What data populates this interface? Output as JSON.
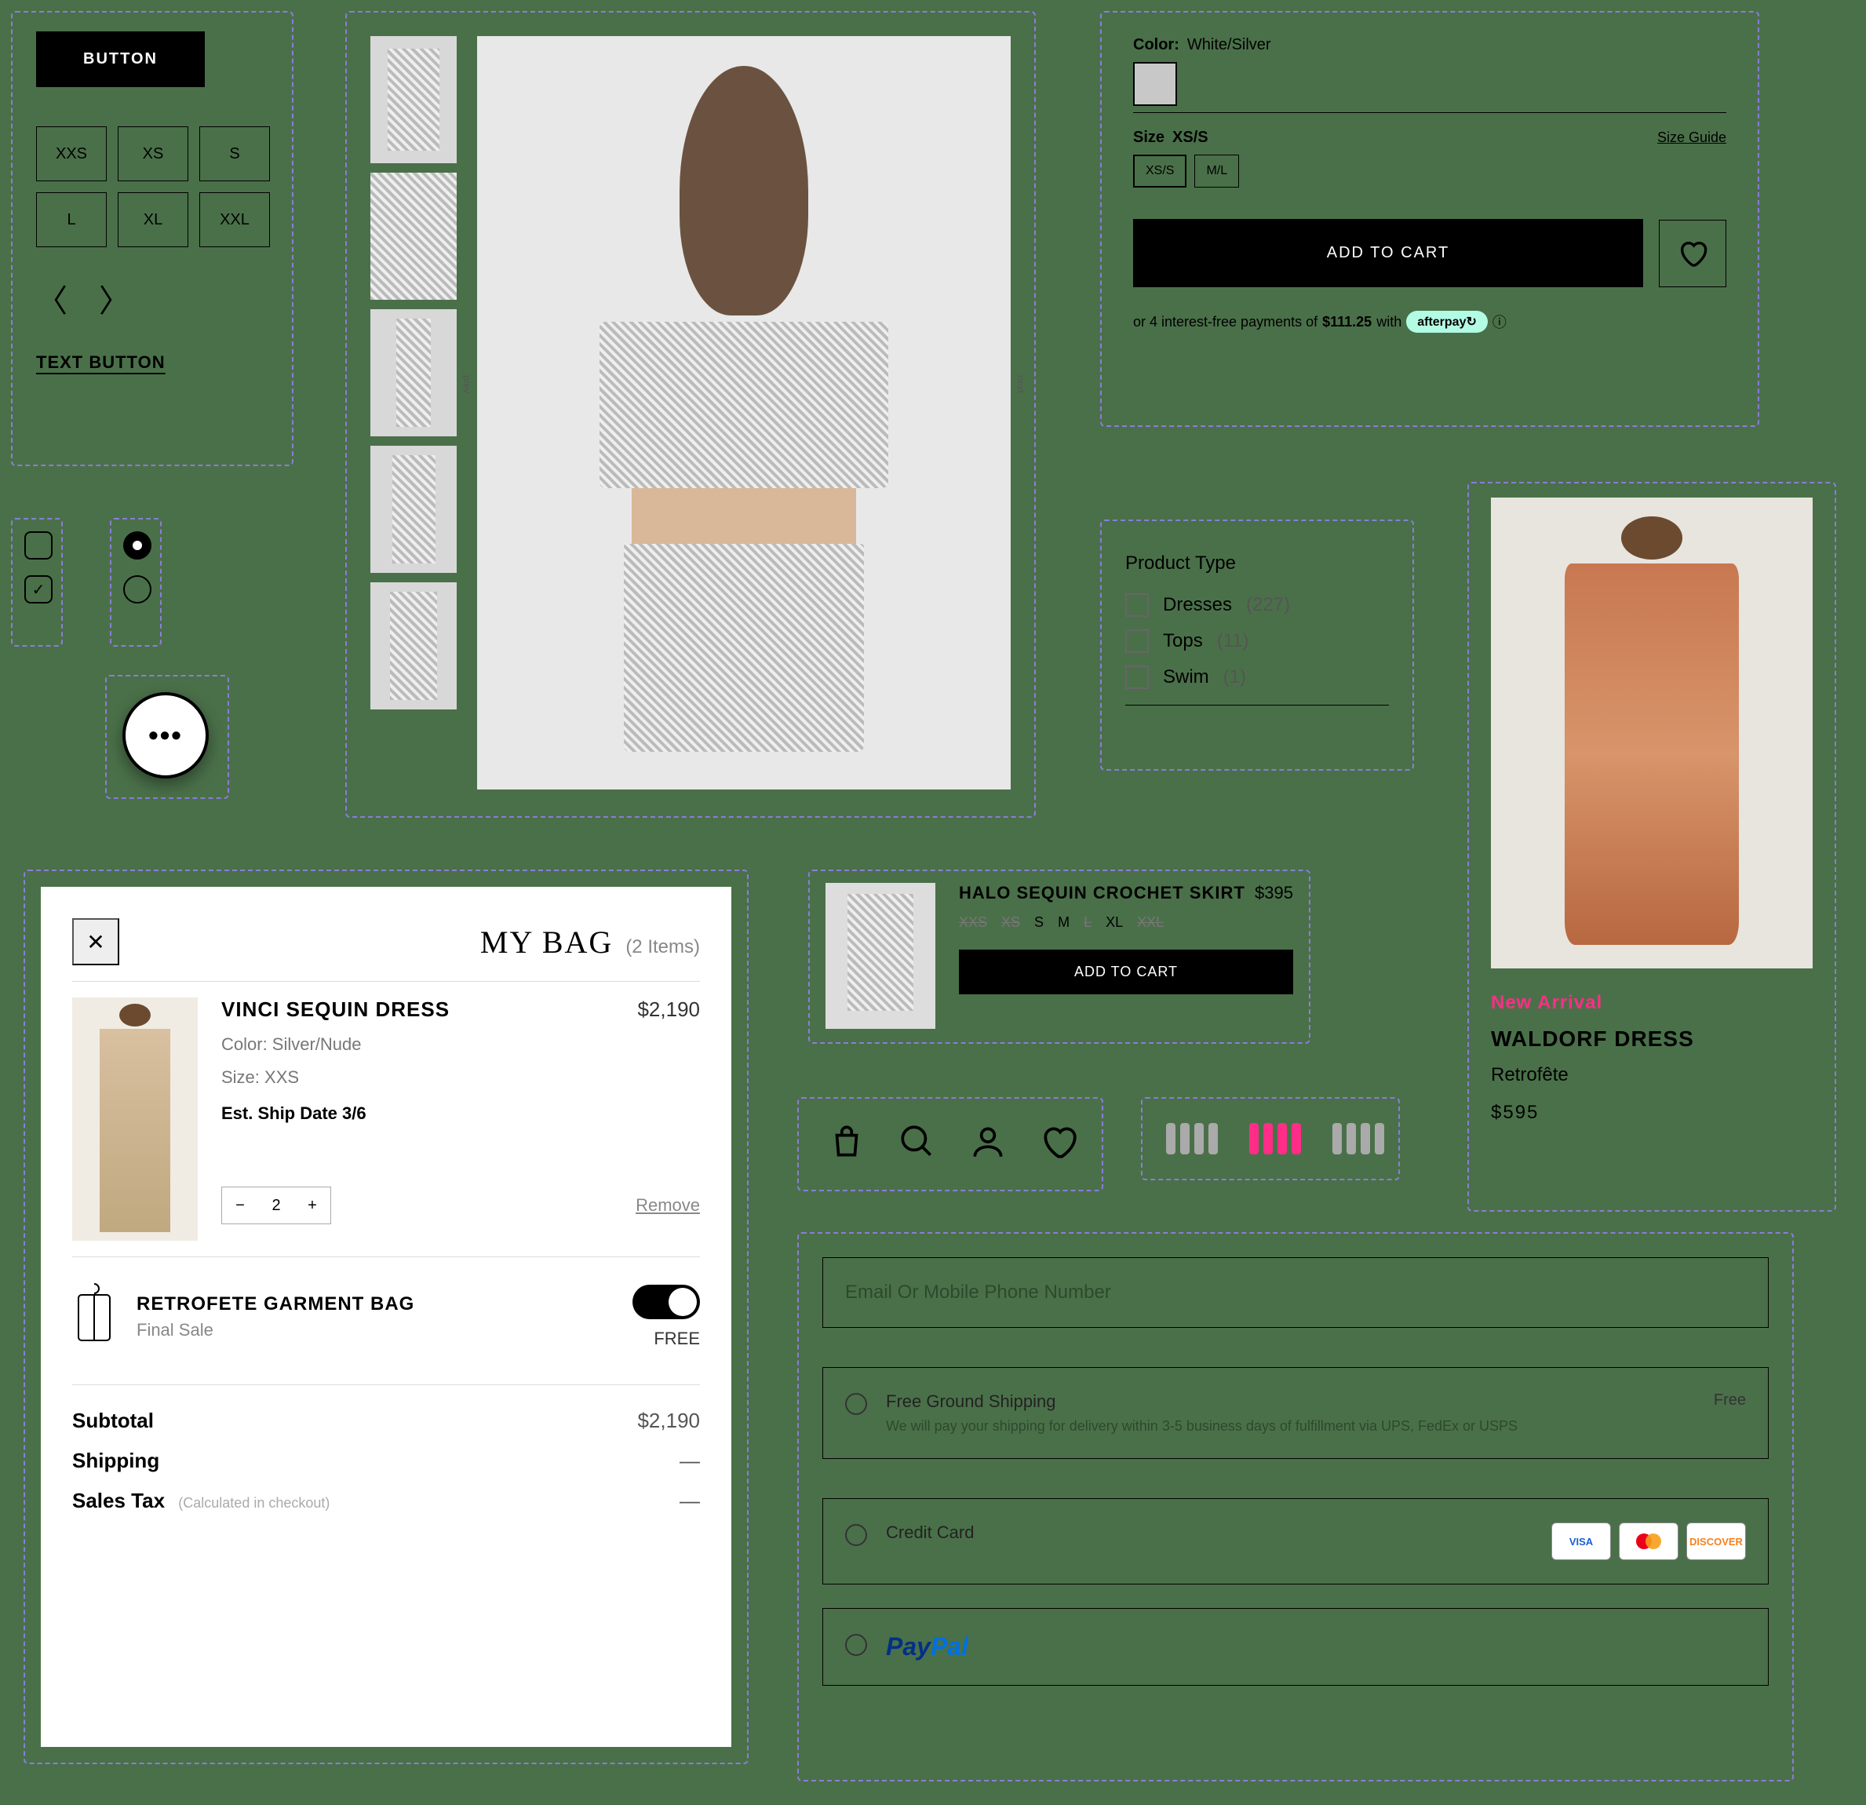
{
  "controls": {
    "primary_button": "BUTTON",
    "sizes": [
      "XXS",
      "XS",
      "S",
      "L",
      "XL",
      "XXL"
    ],
    "text_button": "TEXT BUTTON"
  },
  "gallery": {
    "prev_label": "prev",
    "next_label": "next"
  },
  "buybox": {
    "color_label": "Color:",
    "color_value": "White/Silver",
    "size_label_prefix": "Size",
    "selected_size": "XS/S",
    "size_guide": "Size Guide",
    "size_options": [
      "XS/S",
      "M/L"
    ],
    "cta": "ADD TO CART",
    "afterpay_prefix": "or 4 interest-free payments of",
    "afterpay_amount": "$111.25",
    "afterpay_with": "with",
    "afterpay_brand": "afterpay"
  },
  "filter": {
    "title": "Product Type",
    "items": [
      {
        "name": "Dresses",
        "count": "(227)"
      },
      {
        "name": "Tops",
        "count": "(11)"
      },
      {
        "name": "Swim",
        "count": "(1)"
      }
    ]
  },
  "card": {
    "badge": "New Arrival",
    "title": "WALDORF DRESS",
    "brand": "Retrofête",
    "price": "$595"
  },
  "bag": {
    "title": "MY BAG",
    "count": "(2 Items)",
    "item": {
      "name": "VINCI SEQUIN DRESS",
      "price": "$2,190",
      "color": "Color: Silver/Nude",
      "size": "Size: XXS",
      "ship": "Est. Ship Date 3/6",
      "qty": "2"
    },
    "remove": "Remove",
    "garment": {
      "name": "RETROFETE GARMENT BAG",
      "note": "Final Sale",
      "price": "FREE"
    },
    "totals": {
      "subtotal_label": "Subtotal",
      "subtotal_value": "$2,190",
      "shipping_label": "Shipping",
      "shipping_value": "—",
      "tax_label": "Sales Tax",
      "tax_note": "(Calculated in checkout)",
      "tax_value": "—"
    }
  },
  "quickcard": {
    "title": "HALO SEQUIN CROCHET SKIRT",
    "price": "$395",
    "sizes": [
      {
        "label": "XXS",
        "oos": true
      },
      {
        "label": "XS",
        "oos": true
      },
      {
        "label": "S",
        "oos": false
      },
      {
        "label": "M",
        "oos": false
      },
      {
        "label": "L",
        "oos": true
      },
      {
        "label": "XL",
        "oos": false
      },
      {
        "label": "XXL",
        "oos": true
      }
    ],
    "cta": "ADD TO CART"
  },
  "swatches": {
    "colors": [
      "#aaa",
      "#ff2d87",
      "#aaa"
    ]
  },
  "checkout": {
    "email_placeholder": "Email Or Mobile Phone Number",
    "ship": {
      "title": "Free Ground Shipping",
      "desc": "We will pay your shipping for delivery within 3-5 business days of fulfillment via UPS, FedEx or USPS",
      "price": "Free"
    },
    "cc": {
      "title": "Credit Card",
      "cards": [
        "VISA",
        "MC",
        "DISCOVER"
      ],
      "card_colors": [
        "#1a5fd0",
        "transparent",
        "#f58220"
      ]
    },
    "paypal_p": "Pay",
    "paypal_pal": "Pal"
  }
}
